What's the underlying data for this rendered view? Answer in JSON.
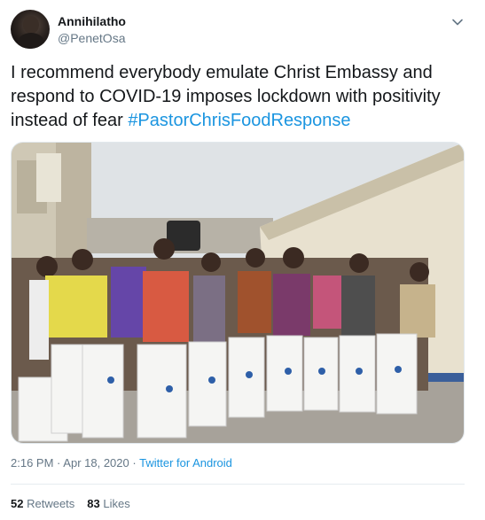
{
  "author": {
    "display_name": "Annihilatho",
    "handle": "@PenetOsa"
  },
  "icons": {
    "menu": "chevron-down-icon",
    "avatar": "avatar-photo"
  },
  "tweet": {
    "text": "I recommend everybody emulate Christ Embassy and respond to COVID-19 imposes lockdown with positivity instead of fear ",
    "hashtag": "#PastorChrisFoodResponse"
  },
  "meta": {
    "time": "2:16 PM",
    "separator": "·",
    "date": "Apr 18, 2020",
    "source": "Twitter for Android"
  },
  "stats": {
    "retweets_count": "52",
    "retweets_label": "Retweets",
    "likes_count": "83",
    "likes_label": "Likes"
  },
  "colors": {
    "text": "#14171a",
    "secondary": "#657786",
    "link": "#1b95e0"
  }
}
